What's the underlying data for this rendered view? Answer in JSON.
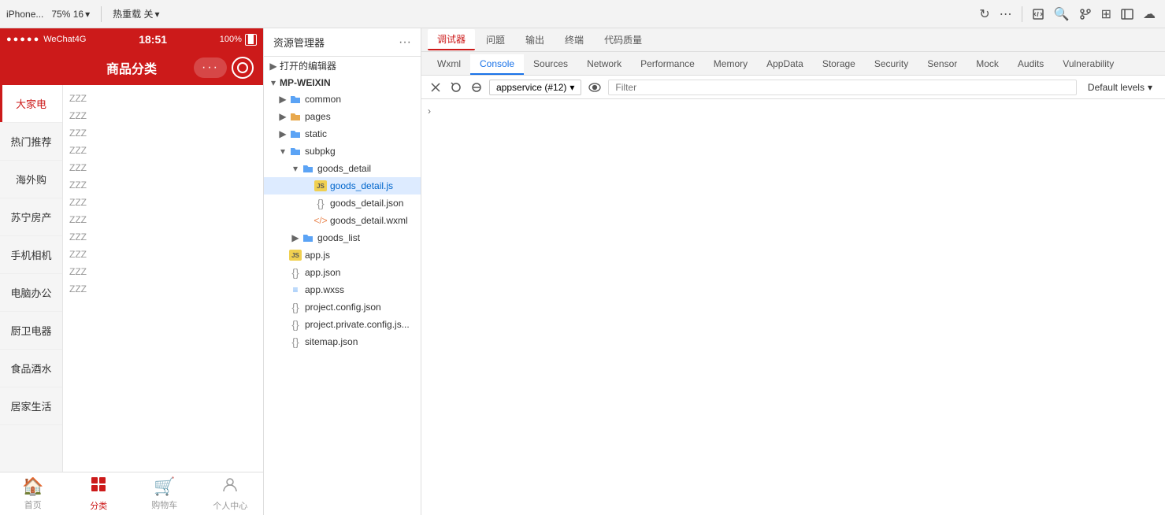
{
  "toolbar": {
    "simulator_label": "iPhone...",
    "zoom_label": "75% 16",
    "hot_reload_label": "热重载 关",
    "more_label": "...",
    "icons": [
      "refresh",
      "more-horiz",
      "file-code",
      "search",
      "git-branch",
      "grid",
      "sidebar",
      "cloud"
    ]
  },
  "file_panel": {
    "title": "资源管理器",
    "more_icon": "···",
    "sections": {
      "open_editors_label": "打开的编辑器",
      "project_label": "MP-WEIXIN",
      "tree": [
        {
          "id": "common",
          "type": "folder",
          "name": "common",
          "level": 1,
          "expanded": false,
          "color": "blue"
        },
        {
          "id": "pages",
          "type": "folder",
          "name": "pages",
          "level": 1,
          "expanded": false,
          "color": "orange"
        },
        {
          "id": "static",
          "type": "folder",
          "name": "static",
          "level": 1,
          "expanded": false,
          "color": "blue"
        },
        {
          "id": "subpkg",
          "type": "folder",
          "name": "subpkg",
          "level": 1,
          "expanded": true,
          "color": "blue"
        },
        {
          "id": "goods_detail",
          "type": "folder",
          "name": "goods_detail",
          "level": 2,
          "expanded": true,
          "color": "blue"
        },
        {
          "id": "goods_detail_js",
          "type": "file",
          "name": "goods_detail.js",
          "level": 3,
          "ext": "js",
          "selected": true
        },
        {
          "id": "goods_detail_json",
          "type": "file",
          "name": "goods_detail.json",
          "level": 3,
          "ext": "json"
        },
        {
          "id": "goods_detail_wxml",
          "type": "file",
          "name": "goods_detail.wxml",
          "level": 3,
          "ext": "wxml"
        },
        {
          "id": "goods_list",
          "type": "folder",
          "name": "goods_list",
          "level": 2,
          "expanded": false,
          "color": "blue"
        },
        {
          "id": "app_js",
          "type": "file",
          "name": "app.js",
          "level": 1,
          "ext": "js"
        },
        {
          "id": "app_json",
          "type": "file",
          "name": "app.json",
          "level": 1,
          "ext": "json"
        },
        {
          "id": "app_wxss",
          "type": "file",
          "name": "app.wxss",
          "level": 1,
          "ext": "wxss"
        },
        {
          "id": "project_config",
          "type": "file",
          "name": "project.config.json",
          "level": 1,
          "ext": "json"
        },
        {
          "id": "project_private",
          "type": "file",
          "name": "project.private.config.js...",
          "level": 1,
          "ext": "json"
        },
        {
          "id": "sitemap",
          "type": "file",
          "name": "sitemap.json",
          "level": 1,
          "ext": "json"
        }
      ]
    }
  },
  "phone": {
    "status": {
      "carrier": "WeChat4G",
      "time": "18:51",
      "battery": "100%"
    },
    "nav_title": "商品分类",
    "categories": [
      {
        "id": "appliances",
        "label": "大家电",
        "active": true
      },
      {
        "id": "hot",
        "label": "热门推荐",
        "active": false
      },
      {
        "id": "overseas",
        "label": "海外购",
        "active": false
      },
      {
        "id": "suning",
        "label": "苏宁房产",
        "active": false
      },
      {
        "id": "camera",
        "label": "手机相机",
        "active": false
      },
      {
        "id": "office",
        "label": "电脑办公",
        "active": false
      },
      {
        "id": "kitchen",
        "label": "厨卫电器",
        "active": false
      },
      {
        "id": "food",
        "label": "食品酒水",
        "active": false
      },
      {
        "id": "home",
        "label": "居家生活",
        "active": false
      }
    ],
    "tab_bar": [
      {
        "id": "home",
        "label": "首页",
        "icon": "🏠",
        "active": false
      },
      {
        "id": "category",
        "label": "分类",
        "icon": "⊞",
        "active": true
      },
      {
        "id": "cart",
        "label": "购物车",
        "icon": "🛒",
        "active": false
      },
      {
        "id": "profile",
        "label": "个人中心",
        "icon": "👤",
        "active": false
      }
    ]
  },
  "devtools": {
    "top_tabs": [
      {
        "id": "debugger",
        "label": "调试器",
        "active": true
      },
      {
        "id": "problems",
        "label": "问题",
        "active": false
      },
      {
        "id": "output",
        "label": "输出",
        "active": false
      },
      {
        "id": "terminal",
        "label": "终端",
        "active": false
      },
      {
        "id": "code_quality",
        "label": "代码质量",
        "active": false
      }
    ],
    "chrome_tabs": [
      {
        "id": "wxml",
        "label": "Wxml",
        "active": false
      },
      {
        "id": "console",
        "label": "Console",
        "active": true
      },
      {
        "id": "sources",
        "label": "Sources",
        "active": false
      },
      {
        "id": "network",
        "label": "Network",
        "active": false
      },
      {
        "id": "performance",
        "label": "Performance",
        "active": false
      },
      {
        "id": "memory",
        "label": "Memory",
        "active": false
      },
      {
        "id": "appdata",
        "label": "AppData",
        "active": false
      },
      {
        "id": "storage",
        "label": "Storage",
        "active": false
      },
      {
        "id": "security",
        "label": "Security",
        "active": false
      },
      {
        "id": "sensor",
        "label": "Sensor",
        "active": false
      },
      {
        "id": "mock",
        "label": "Mock",
        "active": false
      },
      {
        "id": "audits",
        "label": "Audits",
        "active": false
      },
      {
        "id": "vulnerability",
        "label": "Vulnerability",
        "active": false
      }
    ],
    "console_toolbar": {
      "context": "appservice (#12)",
      "filter_placeholder": "Filter",
      "levels": "Default levels"
    }
  }
}
